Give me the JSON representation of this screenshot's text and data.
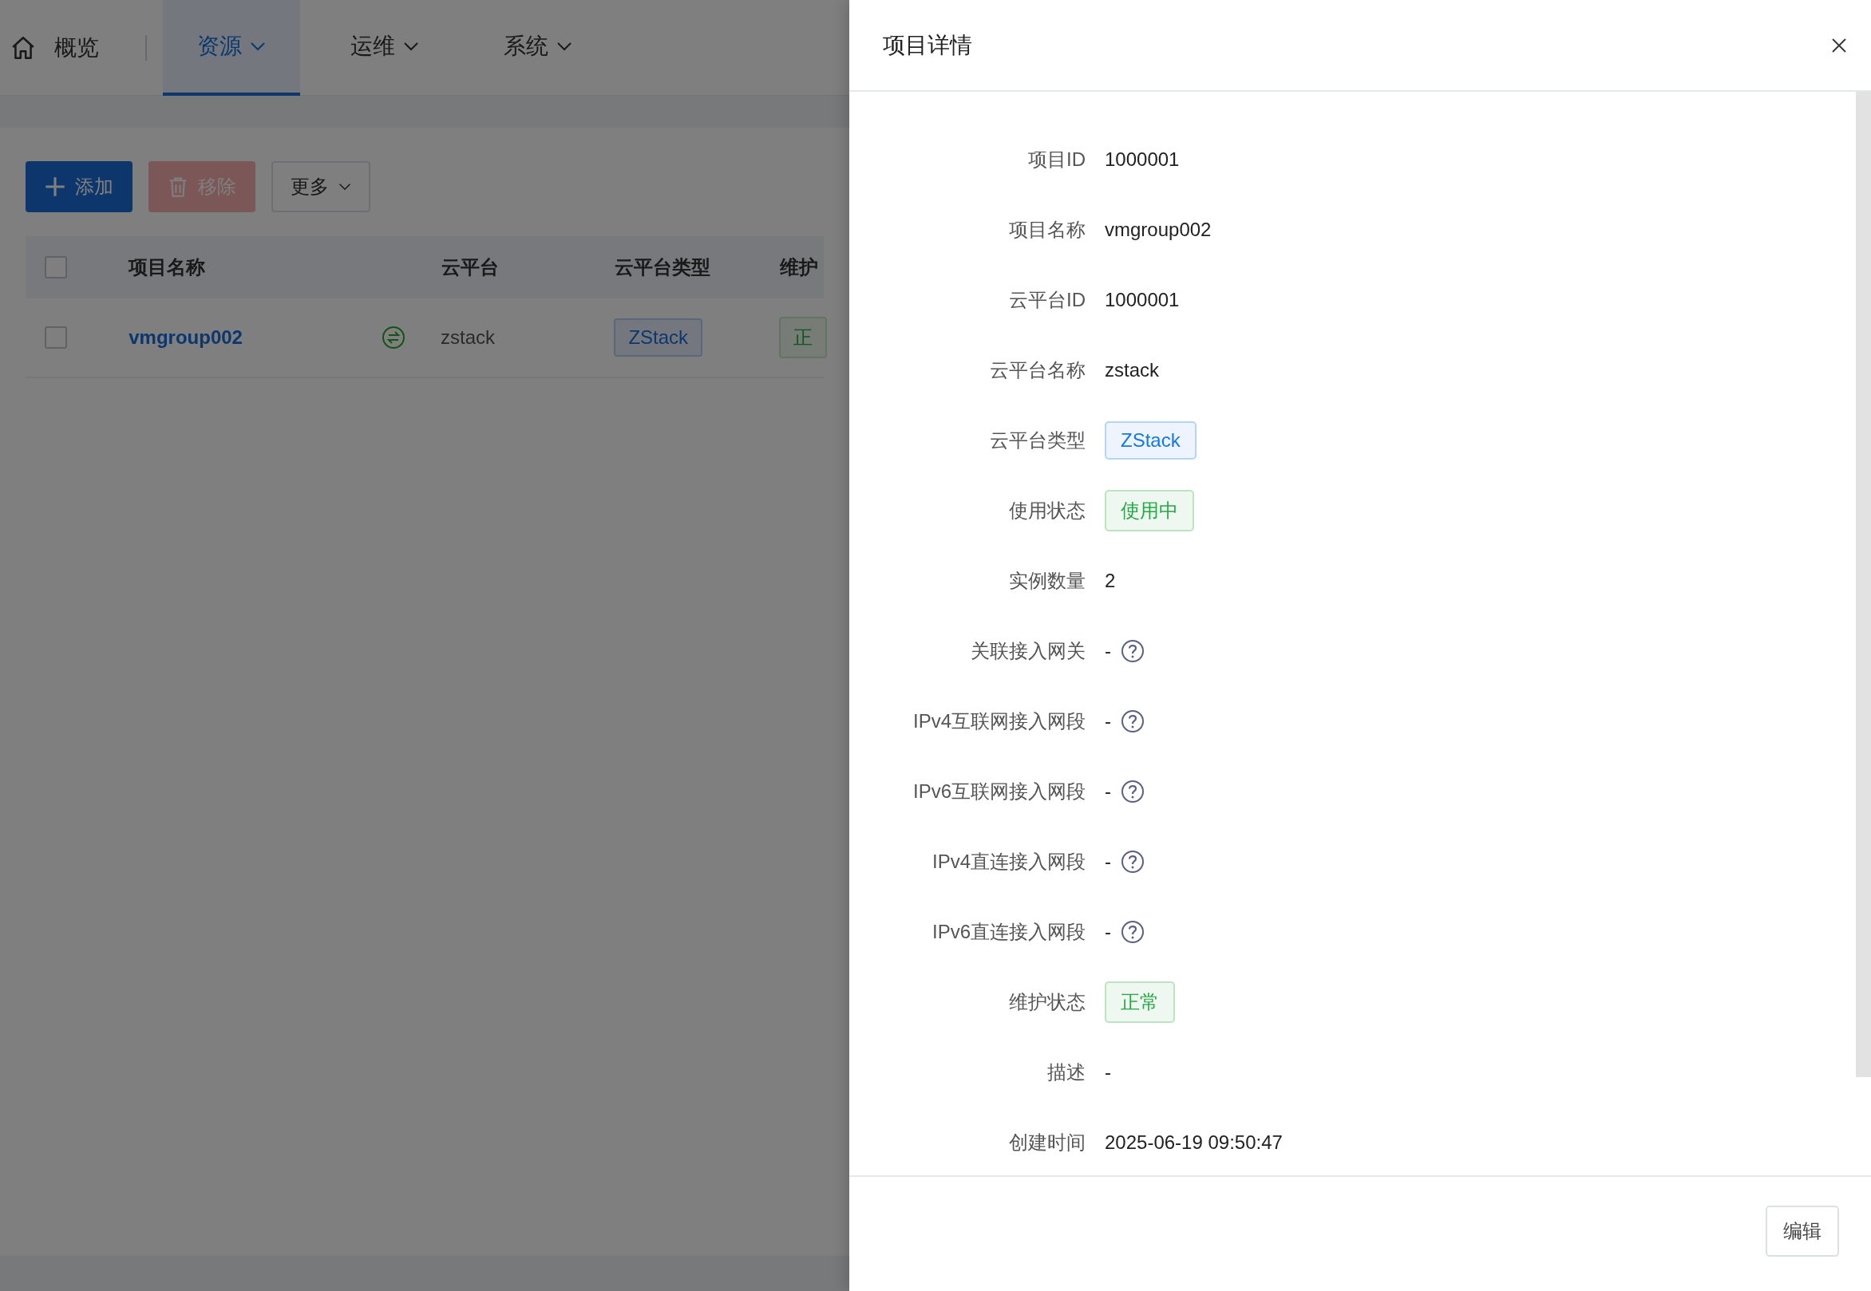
{
  "nav": {
    "home": "概览",
    "tabs": [
      {
        "label": "资源",
        "selected": true
      },
      {
        "label": "运维",
        "selected": false
      },
      {
        "label": "系统",
        "selected": false
      }
    ]
  },
  "toolbar": [
    {
      "label": "添加",
      "kind": "primary",
      "disabled": false
    },
    {
      "label": "移除",
      "kind": "danger",
      "disabled": true
    },
    {
      "label": "更多",
      "kind": "dropdown",
      "disabled": false
    }
  ],
  "table": {
    "header_checked": false,
    "columns": [
      "项目名称",
      "云平台",
      "云平台类型",
      "维护"
    ],
    "rows": [
      {
        "checked": false,
        "name": "vmgroup002",
        "platform": "zstack",
        "type": "ZStack",
        "status": "正"
      }
    ]
  },
  "drawer": {
    "title": "项目详情",
    "fields": [
      {
        "label": "项目ID",
        "kind": "text",
        "value": "1000001"
      },
      {
        "label": "项目名称",
        "kind": "text",
        "value": "vmgroup002"
      },
      {
        "label": "云平台ID",
        "kind": "text",
        "value": "1000001"
      },
      {
        "label": "云平台名称",
        "kind": "text",
        "value": "zstack"
      },
      {
        "label": "云平台类型",
        "kind": "tag",
        "value": "ZStack",
        "color": "#1677e8"
      },
      {
        "label": "使用状态",
        "kind": "tag",
        "value": "使用中",
        "color": "#28a745"
      },
      {
        "label": "实例数量",
        "kind": "text",
        "value": "2"
      },
      {
        "label": "关联接入网关",
        "kind": "help",
        "value": "-"
      },
      {
        "label": "IPv4互联网接入网段",
        "kind": "help",
        "value": "-"
      },
      {
        "label": "IPv6互联网接入网段",
        "kind": "help",
        "value": "-"
      },
      {
        "label": "IPv4直连接入网段",
        "kind": "help",
        "value": "-"
      },
      {
        "label": "IPv6直连接入网段",
        "kind": "help",
        "value": "-"
      },
      {
        "label": "维护状态",
        "kind": "tag",
        "value": "正常",
        "color": "#28a745"
      },
      {
        "label": "描述",
        "kind": "text",
        "value": "-"
      },
      {
        "label": "创建时间",
        "kind": "text",
        "value": "2025-06-19 09:50:47"
      }
    ],
    "buttons": [
      "编辑"
    ]
  }
}
